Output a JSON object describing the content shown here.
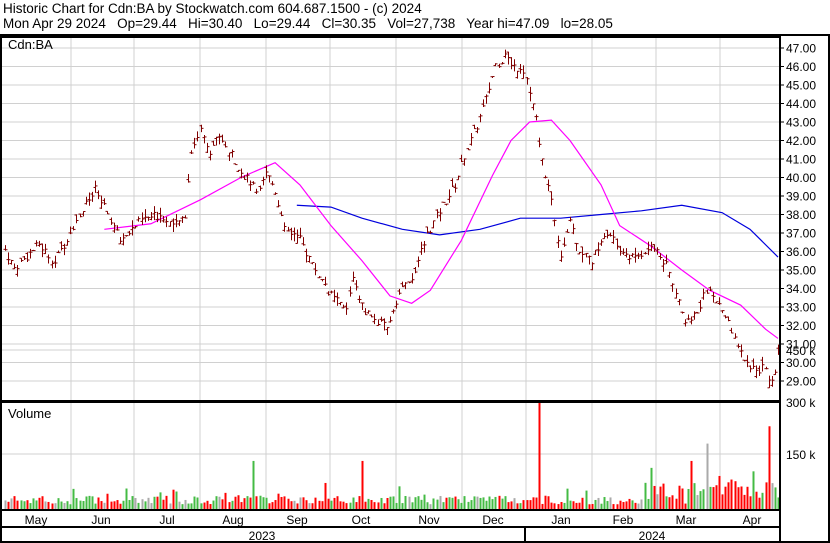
{
  "header": {
    "line1": "Historic Chart for Cdn:BA by Stockwatch.com 604.687.1500 - (c) 2024",
    "line2": "Mon Apr 29 2024   Op=29.44   Hi=30.40   Lo=29.44   Cl=30.35   Vol=27,738   Year hi=47.09   lo=28.05"
  },
  "chart_data": {
    "type": "line",
    "title": "Cdn:BA",
    "volume_label": "Volume",
    "price_ticks": [
      "29.00",
      "30.00",
      "31.00",
      "32.00",
      "33.00",
      "34.00",
      "35.00",
      "36.00",
      "37.00",
      "38.00",
      "39.00",
      "40.00",
      "41.00",
      "42.00",
      "43.00",
      "44.00",
      "45.00",
      "46.00",
      "47.00"
    ],
    "ylim": [
      28,
      47.5
    ],
    "volume_ticks": [
      {
        "v": 150,
        "label": "150 k"
      },
      {
        "v": 300,
        "label": "300 k"
      },
      {
        "v": 450,
        "label": "450 k"
      }
    ],
    "months": [
      "May",
      "Jun",
      "Jul",
      "Aug",
      "Sep",
      "Oct",
      "Nov",
      "Dec",
      "Jan",
      "Feb",
      "Mar",
      "Apr"
    ],
    "years": [
      "2023",
      "2024"
    ],
    "days": 250,
    "colors": {
      "up": "#44bb44",
      "down": "#ff0000",
      "flat": "#aaaaaa",
      "bar": "#800000",
      "ma50": "#ff00ff",
      "ma200": "#0000dd"
    },
    "close_path": [
      [
        0,
        36.1
      ],
      [
        3,
        35.1
      ],
      [
        11,
        36.4
      ],
      [
        16,
        35.4
      ],
      [
        21,
        37.1
      ],
      [
        24,
        38.0
      ],
      [
        29,
        39.3
      ],
      [
        34,
        37.7
      ],
      [
        37,
        36.6
      ],
      [
        44,
        37.7
      ],
      [
        50,
        38.0
      ],
      [
        55,
        37.4
      ],
      [
        58,
        38.0
      ],
      [
        60,
        41.5
      ],
      [
        63,
        42.6
      ],
      [
        66,
        41.5
      ],
      [
        69,
        42.3
      ],
      [
        74,
        40.9
      ],
      [
        77,
        40.1
      ],
      [
        81,
        39.3
      ],
      [
        84,
        40.4
      ],
      [
        87,
        39.3
      ],
      [
        90,
        37.4
      ],
      [
        95,
        36.6
      ],
      [
        100,
        35.0
      ],
      [
        105,
        33.6
      ],
      [
        110,
        32.8
      ],
      [
        112,
        34.7
      ],
      [
        115,
        33.0
      ],
      [
        119,
        32.3
      ],
      [
        123,
        31.8
      ],
      [
        126,
        33.4
      ],
      [
        129,
        34.2
      ],
      [
        132,
        34.7
      ],
      [
        135,
        36.6
      ],
      [
        140,
        38.2
      ],
      [
        145,
        39.6
      ],
      [
        148,
        41.2
      ],
      [
        152,
        42.8
      ],
      [
        155,
        44.2
      ],
      [
        158,
        46.1
      ],
      [
        161,
        46.5
      ],
      [
        165,
        45.9
      ],
      [
        168,
        45.3
      ],
      [
        171,
        43.1
      ],
      [
        173,
        40.9
      ],
      [
        176,
        38.8
      ],
      [
        179,
        35.8
      ],
      [
        182,
        37.7
      ],
      [
        185,
        36.1
      ],
      [
        189,
        35.5
      ],
      [
        192,
        36.6
      ],
      [
        195,
        36.9
      ],
      [
        198,
        36.1
      ],
      [
        203,
        35.6
      ],
      [
        208,
        36.4
      ],
      [
        213,
        35.3
      ],
      [
        216,
        33.9
      ],
      [
        219,
        32.0
      ],
      [
        223,
        32.8
      ],
      [
        226,
        33.9
      ],
      [
        229,
        33.4
      ],
      [
        232,
        32.3
      ],
      [
        235,
        31.5
      ],
      [
        239,
        29.9
      ],
      [
        242,
        29.6
      ],
      [
        245,
        29.7
      ],
      [
        247,
        28.8
      ],
      [
        249,
        30.35
      ]
    ],
    "ma50": [
      [
        32,
        37.2
      ],
      [
        47,
        37.5
      ],
      [
        63,
        38.8
      ],
      [
        76,
        40.0
      ],
      [
        87,
        40.8
      ],
      [
        95,
        39.6
      ],
      [
        105,
        37.4
      ],
      [
        115,
        35.5
      ],
      [
        124,
        33.6
      ],
      [
        131,
        33.2
      ],
      [
        137,
        33.9
      ],
      [
        147,
        36.6
      ],
      [
        157,
        40.1
      ],
      [
        163,
        42.0
      ],
      [
        169,
        43.0
      ],
      [
        176,
        43.1
      ],
      [
        182,
        42.0
      ],
      [
        192,
        39.6
      ],
      [
        198,
        37.4
      ],
      [
        208,
        36.3
      ],
      [
        218,
        35.0
      ],
      [
        227,
        33.9
      ],
      [
        237,
        33.1
      ],
      [
        245,
        31.8
      ],
      [
        249,
        31.3
      ]
    ],
    "ma200": [
      [
        94,
        38.5
      ],
      [
        105,
        38.4
      ],
      [
        115,
        37.8
      ],
      [
        128,
        37.2
      ],
      [
        140,
        36.9
      ],
      [
        153,
        37.2
      ],
      [
        166,
        37.8
      ],
      [
        179,
        37.8
      ],
      [
        192,
        38.0
      ],
      [
        205,
        38.2
      ],
      [
        218,
        38.5
      ],
      [
        231,
        38.1
      ],
      [
        240,
        37.2
      ],
      [
        249,
        35.7
      ]
    ],
    "volume_spikes_k": [
      [
        80,
        130
      ],
      [
        115,
        130
      ],
      [
        172,
        300
      ],
      [
        208,
        110
      ],
      [
        221,
        130
      ],
      [
        226,
        180
      ],
      [
        241,
        100
      ],
      [
        246,
        230
      ]
    ]
  }
}
